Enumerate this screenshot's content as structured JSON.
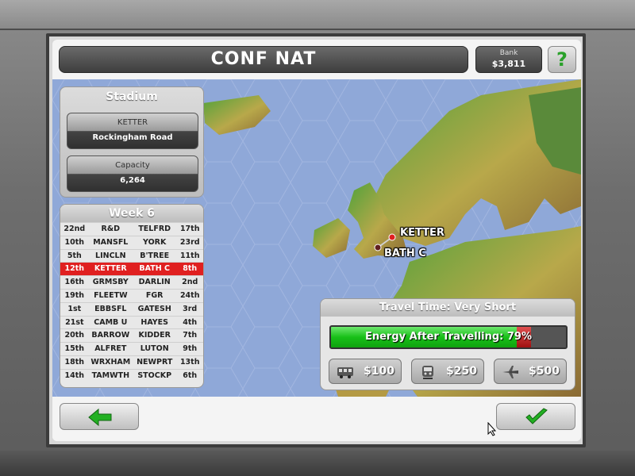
{
  "header": {
    "title": "CONF NAT",
    "bank_label": "Bank",
    "bank_value": "$3,811",
    "help_label": "?"
  },
  "stadium": {
    "title": "Stadium",
    "team": "KETTER",
    "ground": "Rockingham Road",
    "capacity_label": "Capacity",
    "capacity_value": "6,264"
  },
  "league": {
    "title": "Week 6",
    "rows": [
      {
        "home_pos": "22nd",
        "home": "R&D",
        "away": "TELFRD",
        "away_pos": "17th"
      },
      {
        "home_pos": "10th",
        "home": "MANSFL",
        "away": "YORK",
        "away_pos": "23rd"
      },
      {
        "home_pos": "5th",
        "home": "LINCLN",
        "away": "B'TREE",
        "away_pos": "11th"
      },
      {
        "home_pos": "12th",
        "home": "KETTER",
        "away": "BATH C",
        "away_pos": "8th"
      },
      {
        "home_pos": "16th",
        "home": "GRMSBY",
        "away": "DARLIN",
        "away_pos": "2nd"
      },
      {
        "home_pos": "19th",
        "home": "FLEETW",
        "away": "FGR",
        "away_pos": "24th"
      },
      {
        "home_pos": "1st",
        "home": "EBBSFL",
        "away": "GATESH",
        "away_pos": "3rd"
      },
      {
        "home_pos": "21st",
        "home": "CAMB U",
        "away": "HAYES",
        "away_pos": "4th"
      },
      {
        "home_pos": "20th",
        "home": "BARROW",
        "away": "KIDDER",
        "away_pos": "7th"
      },
      {
        "home_pos": "15th",
        "home": "ALFRET",
        "away": "LUTON",
        "away_pos": "9th"
      },
      {
        "home_pos": "18th",
        "home": "WRXHAM",
        "away": "NEWPRT",
        "away_pos": "13th"
      },
      {
        "home_pos": "14th",
        "home": "TAMWTH",
        "away": "STOCKP",
        "away_pos": "6th"
      }
    ],
    "highlight_index": 3,
    "highlight_color": "#e02020"
  },
  "map": {
    "home_label": "KETTER",
    "away_label": "BATH C"
  },
  "travel": {
    "title": "Travel Time: Very Short",
    "energy_text": "Energy After Travelling: 79%",
    "energy_percent": 79,
    "options": [
      {
        "icon": "coach-icon",
        "price": "$100"
      },
      {
        "icon": "train-icon",
        "price": "$250"
      },
      {
        "icon": "plane-icon",
        "price": "$500"
      }
    ]
  },
  "colors": {
    "energy_green": "#18c018",
    "highlight_red": "#e02020",
    "accept_green": "#2aa12a"
  }
}
